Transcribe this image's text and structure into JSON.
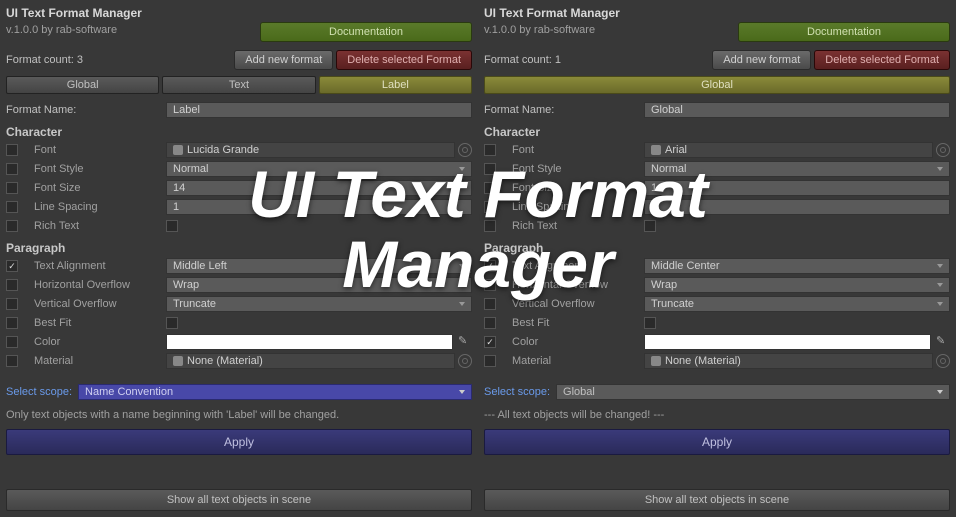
{
  "overlay_title": "UI Text Format\nManager",
  "left": {
    "title": "UI Text Format Manager",
    "version": "v.1.0.0 by rab-software",
    "doc_btn": "Documentation",
    "format_count_label": "Format count: 3",
    "add_btn": "Add new format",
    "del_btn": "Delete selected Format",
    "tabs": [
      "Global",
      "Text",
      "Label"
    ],
    "active_tab": 2,
    "format_name_label": "Format Name:",
    "format_name_value": "Label",
    "section_character": "Character",
    "section_paragraph": "Paragraph",
    "props": {
      "font_label": "Font",
      "font_value": "Lucida Grande",
      "font_style_label": "Font Style",
      "font_style_value": "Normal",
      "font_size_label": "Font Size",
      "font_size_value": "14",
      "line_spacing_label": "Line Spacing",
      "line_spacing_value": "1",
      "rich_text_label": "Rich Text",
      "text_align_label": "Text Alignment",
      "text_align_value": "Middle Left",
      "h_overflow_label": "Horizontal Overflow",
      "h_overflow_value": "Wrap",
      "v_overflow_label": "Vertical Overflow",
      "v_overflow_value": "Truncate",
      "best_fit_label": "Best Fit",
      "color_label": "Color",
      "material_label": "Material",
      "material_value": "None (Material)"
    },
    "scope_label": "Select scope:",
    "scope_value": "Name Convention",
    "scope_info": "Only text objects with a name beginning with 'Label' will be changed.",
    "apply_btn": "Apply",
    "show_btn": "Show all text objects in scene"
  },
  "right": {
    "title": "UI Text Format Manager",
    "version": "v.1.0.0 by rab-software",
    "doc_btn": "Documentation",
    "format_count_label": "Format count: 1",
    "add_btn": "Add new format",
    "del_btn": "Delete selected Format",
    "tabs": [
      "Global"
    ],
    "active_tab": 0,
    "format_name_label": "Format Name:",
    "format_name_value": "Global",
    "section_character": "Character",
    "section_paragraph": "Paragraph",
    "props": {
      "font_label": "Font",
      "font_value": "Arial",
      "font_style_label": "Font Style",
      "font_style_value": "Normal",
      "font_size_label": "Font Size",
      "font_size_value": "14",
      "line_spacing_label": "Line Spacing",
      "line_spacing_value": "1",
      "rich_text_label": "Rich Text",
      "text_align_label": "Text Alignment",
      "text_align_value": "Middle Center",
      "h_overflow_label": "Horizontal Overflow",
      "h_overflow_value": "Wrap",
      "v_overflow_label": "Vertical Overflow",
      "v_overflow_value": "Truncate",
      "best_fit_label": "Best Fit",
      "color_label": "Color",
      "material_label": "Material",
      "material_value": "None (Material)"
    },
    "scope_label": "Select scope:",
    "scope_value": "Global",
    "scope_info": "--- All text objects will be changed! ---",
    "apply_btn": "Apply",
    "show_btn": "Show all text objects in scene"
  }
}
